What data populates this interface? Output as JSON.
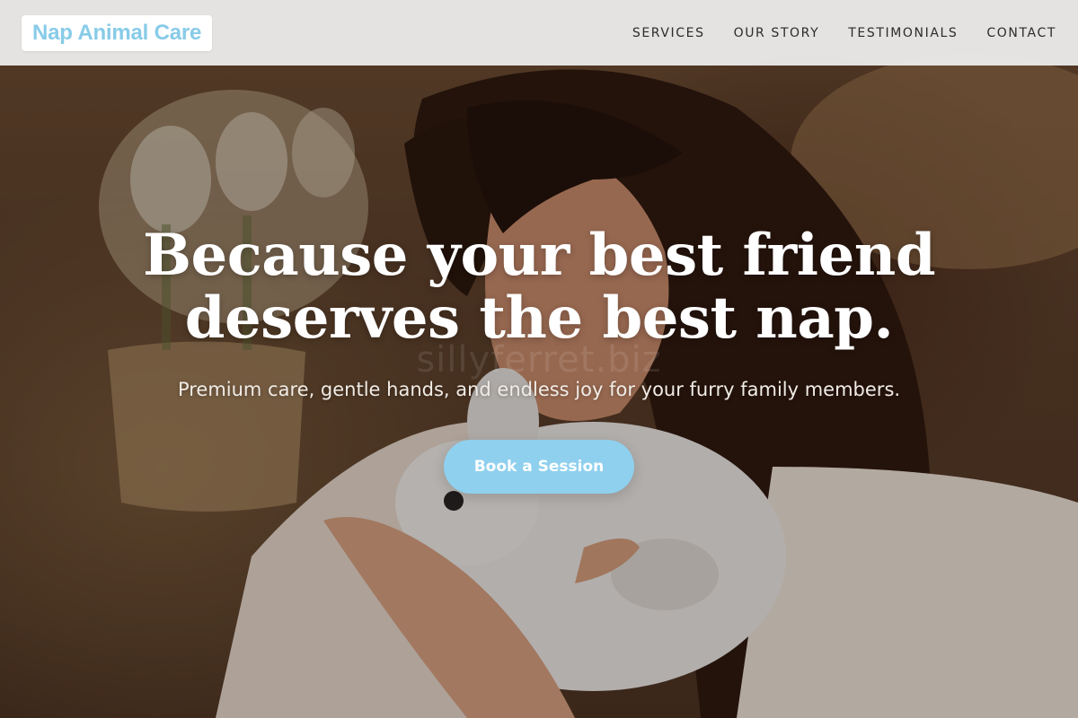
{
  "brand": {
    "name": "Nap Animal Care",
    "color": "#87cbe8"
  },
  "nav": {
    "items": [
      {
        "label": "SERVICES"
      },
      {
        "label": "OUR STORY"
      },
      {
        "label": "TESTIMONIALS"
      },
      {
        "label": "CONTACT"
      }
    ]
  },
  "hero": {
    "headline_line1": "Because your best friend",
    "headline_line2": "deserves the best nap.",
    "subheadline": "Premium care, gentle hands, and endless joy for your furry family members.",
    "watermark": "sillyferret.biz",
    "image_subject": "woman-holding-white-rabbit-photo",
    "cta": {
      "label": "Book a Session",
      "color": "#8fd0ee"
    }
  }
}
